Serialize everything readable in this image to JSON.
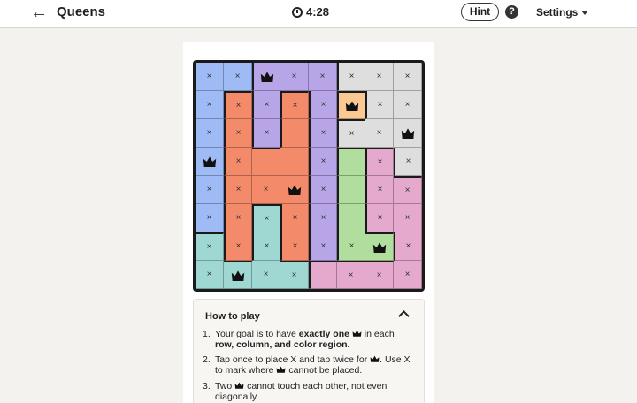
{
  "header": {
    "back_icon": "arrow-left-icon",
    "title": "Queens",
    "timer": "4:28",
    "hint_label": "Hint",
    "help_label": "?",
    "settings_label": "Settings"
  },
  "colors": {
    "blue": "#9ebbf5",
    "purple": "#b7a5e8",
    "gray": "#dedede",
    "red": "#f38b6b",
    "orange": "#fbc894",
    "green": "#b1de9f",
    "pink": "#e4a9cc",
    "teal": "#9fd8d3"
  },
  "board": {
    "regions": [
      [
        "blue",
        "blue",
        "purple",
        "purple",
        "purple",
        "gray",
        "gray",
        "gray"
      ],
      [
        "blue",
        "red",
        "purple",
        "red",
        "purple",
        "orange",
        "gray",
        "gray"
      ],
      [
        "blue",
        "red",
        "purple",
        "red",
        "purple",
        "gray",
        "gray",
        "gray"
      ],
      [
        "blue",
        "red",
        "red",
        "red",
        "purple",
        "green",
        "pink",
        "gray"
      ],
      [
        "blue",
        "red",
        "red",
        "red",
        "purple",
        "green",
        "pink",
        "pink"
      ],
      [
        "blue",
        "red",
        "teal",
        "red",
        "purple",
        "green",
        "pink",
        "pink"
      ],
      [
        "teal",
        "red",
        "teal",
        "red",
        "purple",
        "green",
        "green",
        "pink"
      ],
      [
        "teal",
        "teal",
        "teal",
        "teal",
        "pink",
        "pink",
        "pink",
        "pink"
      ]
    ],
    "marks": [
      [
        "x",
        "x",
        "Q",
        "x",
        "x",
        "x",
        "x",
        "x"
      ],
      [
        "x",
        "x",
        "x",
        "x",
        "x",
        "Q",
        "x",
        "x"
      ],
      [
        "x",
        "x",
        "x",
        "",
        "x",
        "x",
        "x",
        "Q"
      ],
      [
        "Q",
        "x",
        "",
        "",
        "x",
        "",
        "x",
        "x"
      ],
      [
        "x",
        "x",
        "x",
        "Q",
        "x",
        "",
        "x",
        "x"
      ],
      [
        "x",
        "x",
        "x",
        "x",
        "x",
        "",
        "x",
        "x"
      ],
      [
        "x",
        "x",
        "x",
        "x",
        "x",
        "x",
        "Q",
        "x"
      ],
      [
        "x",
        "Q",
        "x",
        "x",
        "",
        "x",
        "x",
        "x"
      ]
    ],
    "x_symbol": "×"
  },
  "howto": {
    "title": "How to play",
    "rule1_num": "1.",
    "rule1_a": "Your goal is to have ",
    "rule1_b": "exactly one",
    "rule1_c": " in each ",
    "rule1_d": "row, column, and color region.",
    "rule2_num": "2.",
    "rule2_a": "Tap once to place X and tap twice for",
    "rule2_b": ". Use X to mark where",
    "rule2_c": " cannot be placed.",
    "rule3_num": "3.",
    "rule3_a": "Two",
    "rule3_b": " cannot touch each other, not even diagonally."
  }
}
